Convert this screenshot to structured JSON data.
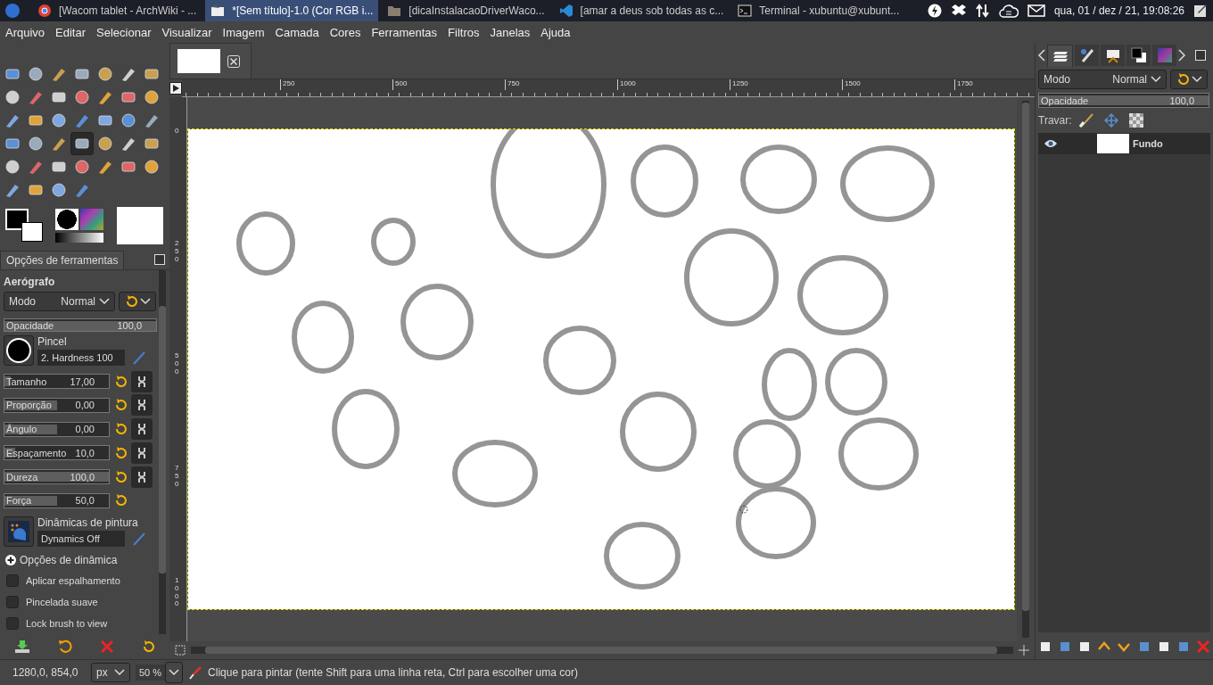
{
  "top_panel": {
    "tasks": [
      {
        "kind": "browser",
        "title": "[Wacom tablet - ArchWiki - ...",
        "selected": false
      },
      {
        "kind": "gimp",
        "title": "*[Sem título]-1.0 (Cor RGB i...",
        "selected": true
      },
      {
        "kind": "folder",
        "title": "[dicaInstalacaoDriverWaco...",
        "selected": false
      },
      {
        "kind": "editor",
        "title": "[amar a deus sob todas as c...",
        "selected": false
      },
      {
        "kind": "terminal",
        "title": "Terminal - xubuntu@xubunt...",
        "selected": false
      }
    ],
    "clock": "qua, 01 / dez / 21, 19:08:26"
  },
  "menu": [
    "Arquivo",
    "Editar",
    "Selecionar",
    "Visualizar",
    "Imagem",
    "Camada",
    "Cores",
    "Ferramentas",
    "Filtros",
    "Janelas",
    "Ajuda"
  ],
  "toolbox": {
    "tools": [
      {
        "selected": false
      },
      {
        "selected": false
      },
      {
        "selected": false
      },
      {
        "selected": false
      },
      {
        "selected": false
      },
      {
        "selected": false
      },
      {
        "selected": false
      },
      {
        "selected": false
      },
      {
        "selected": false
      },
      {
        "selected": false
      },
      {
        "selected": false
      },
      {
        "selected": false
      },
      {
        "selected": false
      },
      {
        "selected": false
      },
      {
        "selected": false
      },
      {
        "selected": false
      },
      {
        "selected": false
      },
      {
        "selected": false
      },
      {
        "selected": false
      },
      {
        "selected": false
      },
      {
        "selected": false
      },
      {
        "selected": false
      },
      {
        "selected": false
      },
      {
        "selected": false
      },
      {
        "selected": true
      },
      {
        "selected": false
      },
      {
        "selected": false
      },
      {
        "selected": false
      },
      {
        "selected": false
      },
      {
        "selected": false
      },
      {
        "selected": false
      },
      {
        "selected": false
      },
      {
        "selected": false
      },
      {
        "selected": false
      },
      {
        "selected": false
      },
      {
        "selected": false
      },
      {
        "selected": false
      },
      {
        "selected": false
      },
      {
        "selected": false
      }
    ]
  },
  "tool_options": {
    "tab": "Opções de ferramentas",
    "tool": "Aerógrafo",
    "mode_label": "Modo",
    "mode": "Normal",
    "opacity": {
      "label": "Opacidade",
      "value": "100,0",
      "level": 1
    },
    "brush": {
      "label": "Pincel",
      "value": "2. Hardness 100"
    },
    "sliders": [
      {
        "kind": "chain",
        "label": "Tamanho",
        "value": "17,00",
        "level": 0.06
      },
      {
        "kind": "chain",
        "label": "Proporção",
        "value": "0,00",
        "level": 0.5
      },
      {
        "kind": "chain",
        "label": "Ângulo",
        "value": "0,00",
        "level": 0.5
      },
      {
        "kind": "chain",
        "label": "Espaçamento",
        "value": "10,0",
        "level": 0.1
      },
      {
        "kind": "chain",
        "label": "Dureza",
        "value": "100,0",
        "level": 1
      },
      {
        "kind": "reset",
        "label": "Força",
        "value": "50,0",
        "level": 0.5
      }
    ],
    "dynamics": {
      "label": "Dinâmicas de pintura",
      "value": "Dynamics Off"
    },
    "dynamic_options": "Opções de dinâmica",
    "checkboxes": [
      {
        "label": "Aplicar espalhamento",
        "checked": false
      },
      {
        "label": "Pincelada suave",
        "checked": false
      },
      {
        "label": "Lock brush to view",
        "checked": false
      }
    ]
  },
  "rulers": {
    "horizontal": [
      "250",
      "500",
      "750",
      "1000",
      "1250",
      "1500",
      "1750"
    ],
    "vertical": [
      "0",
      "250",
      "500",
      "750",
      "1000"
    ]
  },
  "status": {
    "coords": "1280,0, 854,0",
    "unit": "px",
    "zoom": "50 %",
    "message": "Clique para pintar (tente Shift para uma linha reta, Ctrl para escolher uma cor)"
  },
  "layers_panel": {
    "dock_tabs": [
      {
        "selected": true
      },
      {
        "selected": false
      },
      {
        "selected": false
      },
      {
        "selected": false
      },
      {
        "selected": false
      }
    ],
    "mode_label": "Modo",
    "mode": "Normal",
    "opacity": {
      "label": "Opacidade",
      "value": "100,0",
      "level": 1
    },
    "lock_label": "Travar:",
    "layers": [
      {
        "name": "Fundo",
        "visible": true,
        "selected": true
      }
    ]
  }
}
